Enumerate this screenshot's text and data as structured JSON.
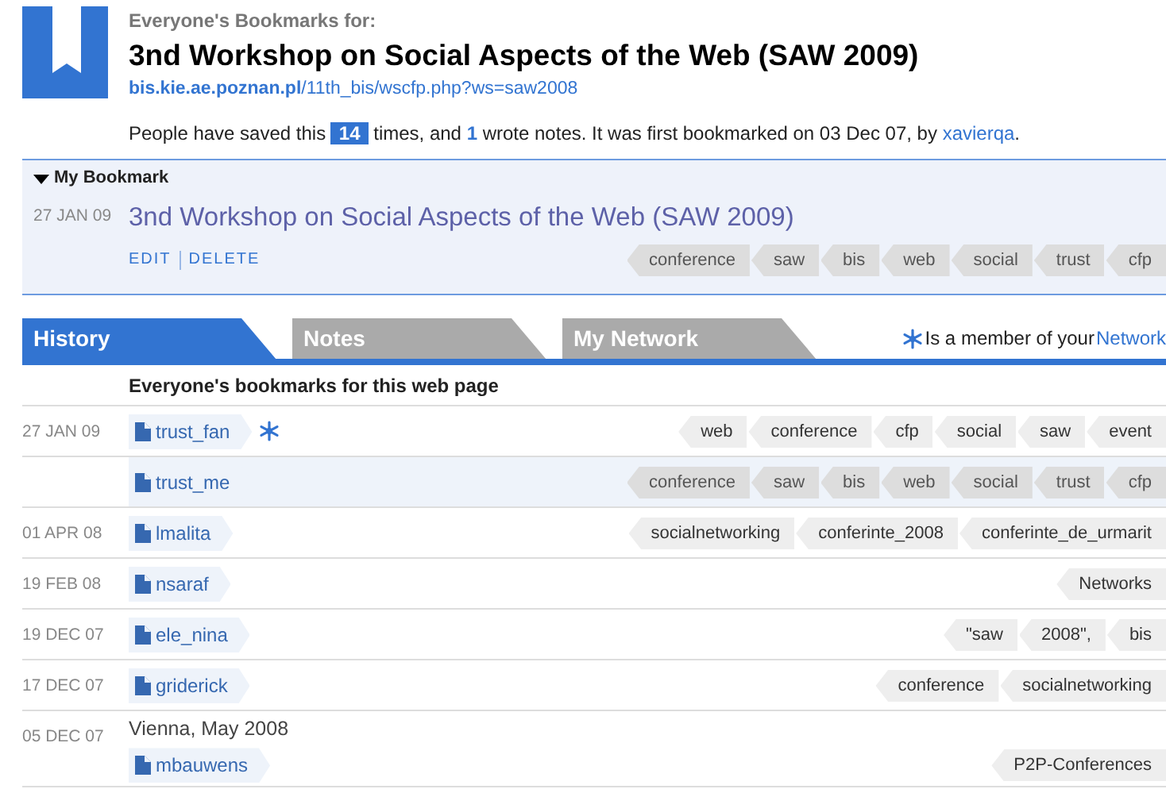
{
  "header": {
    "kicker": "Everyone's Bookmarks for:",
    "title": "3nd Workshop on Social Aspects of the Web (SAW 2009)",
    "url_domain": "bis.kie.ae.poznan.pl",
    "url_path": "/11th_bis/wscfp.php?ws=saw2008"
  },
  "summary": {
    "before": "People have saved this",
    "count": "14",
    "middle": "times, and",
    "notes": "1",
    "after": "wrote notes. It was first bookmarked on 03 Dec 07, by",
    "user": "xavierqa",
    "end": "."
  },
  "my_bookmark": {
    "heading": "My Bookmark",
    "expanded": true,
    "date": "27 JAN 09",
    "title": "3nd Workshop on Social Aspects of the Web (SAW 2009)",
    "actions": [
      "EDIT",
      "DELETE"
    ],
    "tags": [
      "conference",
      "saw",
      "bis",
      "web",
      "social",
      "trust",
      "cfp"
    ]
  },
  "tabs": [
    {
      "label": "History",
      "selected": true
    },
    {
      "label": "Notes",
      "selected": false
    },
    {
      "label": "My Network",
      "selected": false
    }
  ],
  "legend": {
    "text": "Is a member of your",
    "link": "Network"
  },
  "history": {
    "heading": "Everyone's bookmarks for this web page",
    "rows": [
      {
        "date": "27 JAN 09",
        "user": "trust_fan",
        "network": true,
        "mine": false,
        "tags": [
          "web",
          "conference",
          "cfp",
          "social",
          "saw",
          "event"
        ]
      },
      {
        "user": "trust_me",
        "network": false,
        "mine": true,
        "tags": [
          "conference",
          "saw",
          "bis",
          "web",
          "social",
          "trust",
          "cfp"
        ]
      },
      {
        "date": "01 APR 08",
        "user": "lmalita",
        "network": false,
        "mine": false,
        "tags": [
          "socialnetworking",
          "conferinte_2008",
          "conferinte_de_urmarit"
        ]
      },
      {
        "date": "19 FEB 08",
        "user": "nsaraf",
        "network": false,
        "mine": false,
        "tags": [
          "Networks"
        ]
      },
      {
        "date": "19 DEC 07",
        "user": "ele_nina",
        "network": false,
        "mine": false,
        "tags": [
          "\"saw",
          "2008\",",
          "bis"
        ]
      },
      {
        "date": "17 DEC 07",
        "user": "griderick",
        "network": false,
        "mine": false,
        "tags": [
          "conference",
          "socialnetworking"
        ]
      },
      {
        "date": "05 DEC 07",
        "note": "Vienna, May 2008",
        "user": "mbauwens",
        "network": false,
        "mine": false,
        "tags": [
          "P2P-Conferences"
        ]
      }
    ]
  }
}
